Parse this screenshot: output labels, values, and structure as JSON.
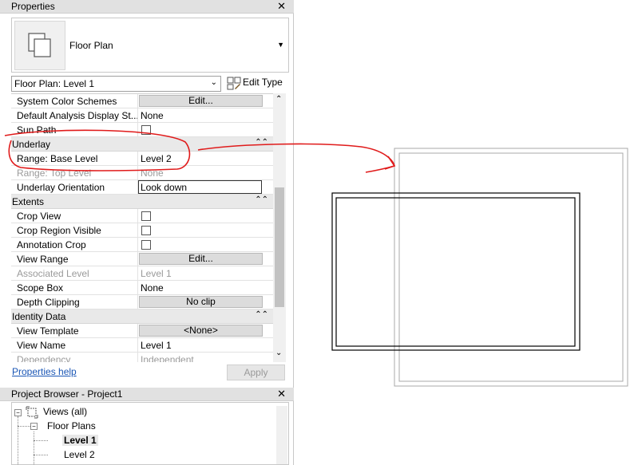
{
  "properties": {
    "title": "Properties",
    "type_name": "Floor Plan",
    "selector_value": "Floor Plan: Level 1",
    "edit_type_label": "Edit Type",
    "rows": [
      {
        "name": "System Color Schemes",
        "value": "Edit..."
      },
      {
        "name": "Default Analysis Display St...",
        "value": "None"
      },
      {
        "name": "Sun Path",
        "value": ""
      },
      {
        "group": "Underlay"
      },
      {
        "name": "Range: Base Level",
        "value": "Level 2"
      },
      {
        "name": "Range: Top Level",
        "value": "None"
      },
      {
        "name": "Underlay Orientation",
        "value": "Look down"
      },
      {
        "group": "Extents"
      },
      {
        "name": "Crop View",
        "value": ""
      },
      {
        "name": "Crop Region Visible",
        "value": ""
      },
      {
        "name": "Annotation Crop",
        "value": ""
      },
      {
        "name": "View Range",
        "value": "Edit..."
      },
      {
        "name": "Associated Level",
        "value": "Level 1"
      },
      {
        "name": "Scope Box",
        "value": "None"
      },
      {
        "name": "Depth Clipping",
        "value": "No clip"
      },
      {
        "group": "Identity Data"
      },
      {
        "name": "View Template",
        "value": "<None>"
      },
      {
        "name": "View Name",
        "value": "Level 1"
      },
      {
        "name": "Dependency",
        "value": "Independent"
      }
    ],
    "help_link": "Properties help",
    "apply_label": "Apply"
  },
  "project_browser": {
    "title": "Project Browser - Project1",
    "root": "Views (all)",
    "floor_plans": "Floor Plans",
    "level_1": "Level 1",
    "level_2": "Level 2"
  },
  "icons": {
    "close": "close-icon",
    "collapse": "collapse-icon",
    "edit_type": "edit-type-icon",
    "floor_plan_thumb": "floor-plan-icon"
  },
  "colors": {
    "annotation": "#e01b1b",
    "link": "#1a56b5"
  }
}
